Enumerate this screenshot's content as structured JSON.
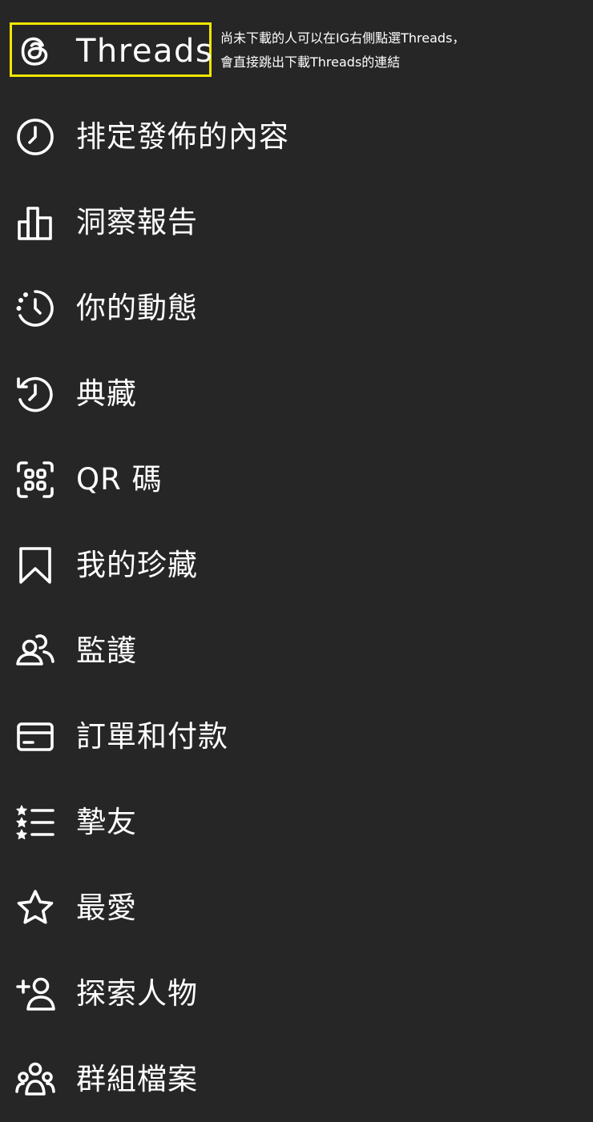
{
  "menu": {
    "threads": {
      "label": "Threads",
      "icon": "threads-icon"
    },
    "note": {
      "line1": "尚未下載的人可以在IG右側點選Threads，",
      "line2": "會直接跳出下載Threads的連結",
      "highlight_color": "#f2e600"
    },
    "items": [
      {
        "label": "排定發佈的內容",
        "icon": "clock-icon"
      },
      {
        "label": "洞察報告",
        "icon": "bar-chart-icon"
      },
      {
        "label": "你的動態",
        "icon": "activity-icon"
      },
      {
        "label": "典藏",
        "icon": "archive-icon"
      },
      {
        "label": "QR 碼",
        "icon": "qr-code-icon"
      },
      {
        "label": "我的珍藏",
        "icon": "bookmark-icon"
      },
      {
        "label": "監護",
        "icon": "supervision-icon"
      },
      {
        "label": "訂單和付款",
        "icon": "card-icon"
      },
      {
        "label": "摯友",
        "icon": "close-friends-icon"
      },
      {
        "label": "最愛",
        "icon": "star-icon"
      },
      {
        "label": "探索人物",
        "icon": "add-person-icon"
      },
      {
        "label": "群組檔案",
        "icon": "group-icon"
      }
    ]
  },
  "colors": {
    "background": "#262626",
    "text": "#ffffff",
    "highlight": "#f2e600"
  }
}
